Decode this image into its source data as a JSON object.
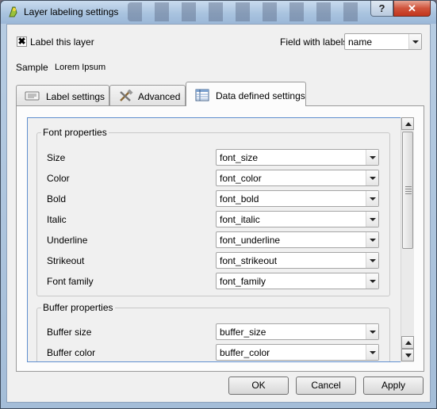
{
  "window": {
    "title": "Layer labeling settings",
    "help_glyph": "?",
    "close_glyph": "✕"
  },
  "top": {
    "label_this_layer": "Label this layer",
    "label_this_layer_checked": true,
    "checkbox_glyph": "✖",
    "field_with_labels_label": "Field with labels",
    "field_with_labels_value": "name",
    "sample_label": "Sample",
    "sample_value": "Lorem Ipsum"
  },
  "tabs": [
    {
      "label": "Label settings",
      "icon": "label-settings-icon",
      "active": false
    },
    {
      "label": "Advanced",
      "icon": "tools-icon",
      "active": false
    },
    {
      "label": "Data defined settings",
      "icon": "table-icon",
      "active": true
    }
  ],
  "font_group": {
    "title": "Font properties",
    "rows": [
      {
        "label": "Size",
        "value": "font_size"
      },
      {
        "label": "Color",
        "value": "font_color"
      },
      {
        "label": "Bold",
        "value": "font_bold"
      },
      {
        "label": "Italic",
        "value": "font_italic"
      },
      {
        "label": "Underline",
        "value": "font_underline"
      },
      {
        "label": "Strikeout",
        "value": "font_strikeout"
      },
      {
        "label": "Font family",
        "value": "font_family"
      }
    ]
  },
  "buffer_group": {
    "title": "Buffer properties",
    "rows": [
      {
        "label": "Buffer size",
        "value": "buffer_size"
      },
      {
        "label": "Buffer color",
        "value": "buffer_color"
      }
    ]
  },
  "buttons": {
    "ok": "OK",
    "cancel": "Cancel",
    "apply": "Apply"
  },
  "colors": {
    "title_bar": "#a9c3df",
    "close_button": "#c2351d",
    "focus_border": "#5f8fcf"
  }
}
